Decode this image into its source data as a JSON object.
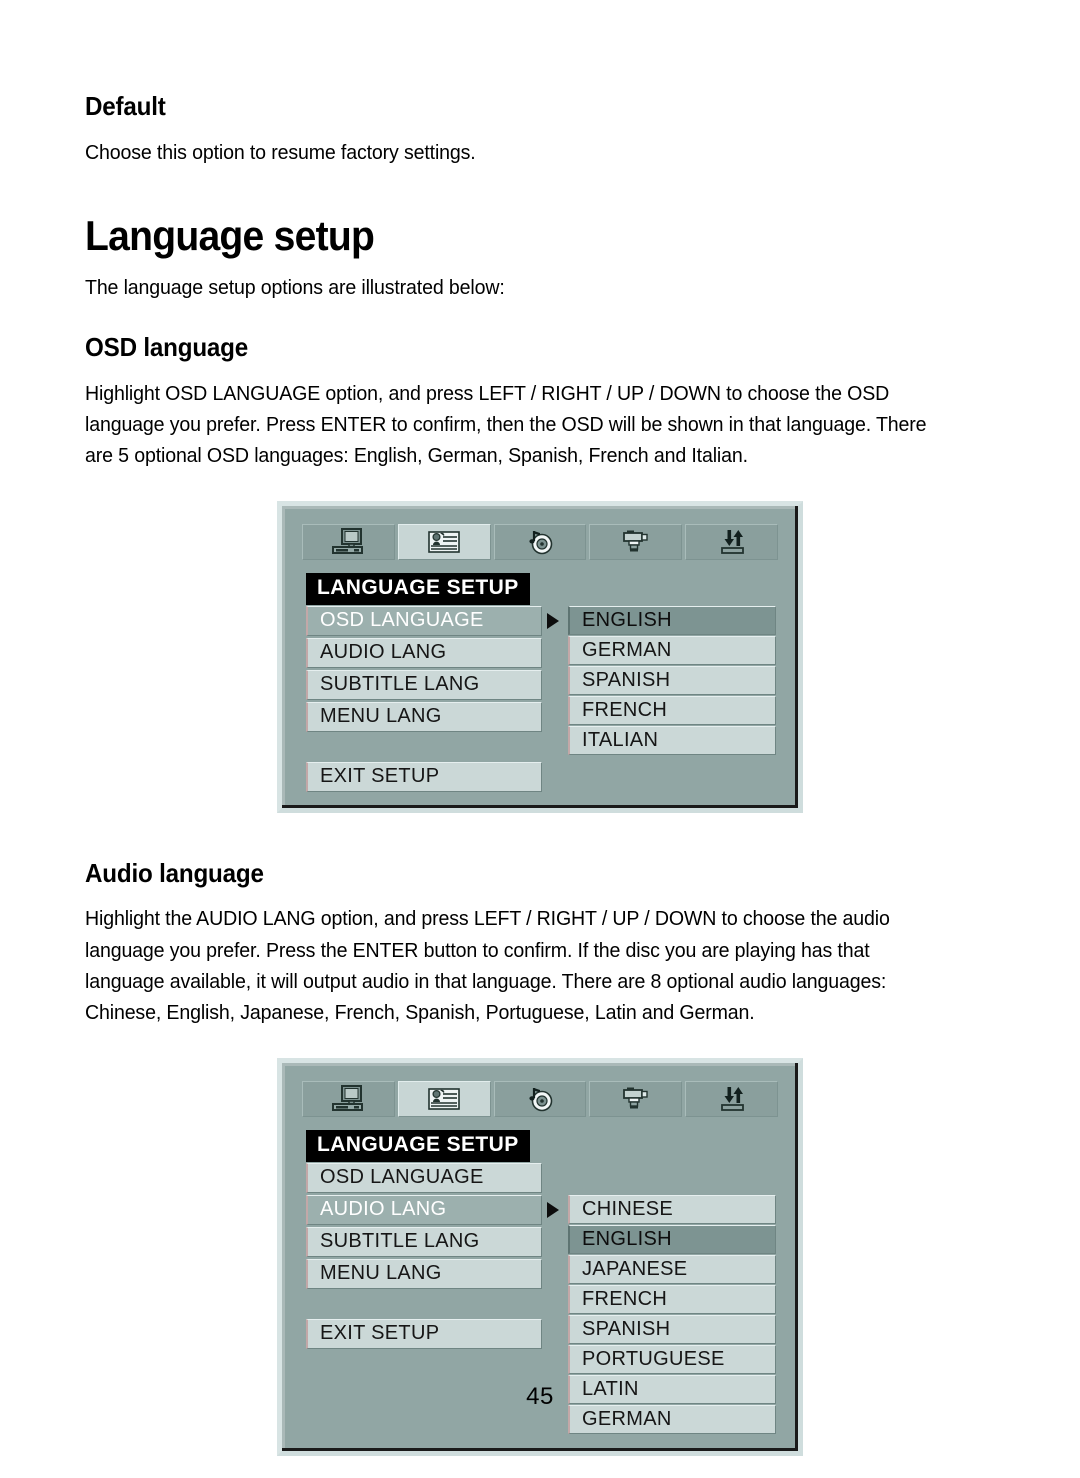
{
  "page": {
    "number": "45"
  },
  "sections": {
    "default": {
      "heading": "Default",
      "body": "Choose this option to resume factory settings."
    },
    "language_setup": {
      "heading": "Language setup",
      "body": "The language setup options are illustrated below:"
    },
    "osd_language": {
      "heading": "OSD language",
      "body": "Highlight OSD LANGUAGE option, and press LEFT / RIGHT / UP / DOWN to choose the OSD language you prefer. Press ENTER to confirm, then the OSD will be shown in that language. There are 5 optional OSD languages: English, German, Spanish, French and Italian."
    },
    "audio_language": {
      "heading": "Audio language",
      "body": "Highlight the AUDIO LANG option, and press LEFT / RIGHT / UP / DOWN to choose the audio language you prefer. Press the ENTER button to confirm. If the disc you are playing has that language available, it will output audio in that language. There are 8 optional audio languages: Chinese, English, Japanese, French, Spanish, Portuguese, Latin and German."
    }
  },
  "osd_tabs": [
    {
      "icon": "monitor-icon",
      "active": false
    },
    {
      "icon": "language-person-icon",
      "active": true
    },
    {
      "icon": "audio-disc-icon",
      "active": false
    },
    {
      "icon": "video-camera-icon",
      "active": false
    },
    {
      "icon": "preference-arrows-icon",
      "active": false
    }
  ],
  "osd_menu_1": {
    "title": "LANGUAGE SETUP",
    "items": [
      {
        "label": "OSD LANGUAGE",
        "selected": true
      },
      {
        "label": "AUDIO LANG",
        "selected": false
      },
      {
        "label": "SUBTITLE LANG",
        "selected": false
      },
      {
        "label": "MENU LANG",
        "selected": false
      }
    ],
    "exit_label": "EXIT SETUP",
    "options": [
      {
        "label": "ENGLISH",
        "highlighted": true
      },
      {
        "label": "GERMAN",
        "highlighted": false
      },
      {
        "label": "SPANISH",
        "highlighted": false
      },
      {
        "label": "FRENCH",
        "highlighted": false
      },
      {
        "label": "ITALIAN",
        "highlighted": false
      }
    ]
  },
  "osd_menu_2": {
    "title": "LANGUAGE SETUP",
    "items": [
      {
        "label": "OSD LANGUAGE",
        "selected": false
      },
      {
        "label": "AUDIO LANG",
        "selected": true
      },
      {
        "label": "SUBTITLE LANG",
        "selected": false
      },
      {
        "label": "MENU LANG",
        "selected": false
      }
    ],
    "exit_label": "EXIT SETUP",
    "options": [
      {
        "label": "CHINESE",
        "highlighted": false
      },
      {
        "label": "ENGLISH",
        "highlighted": true
      },
      {
        "label": "JAPANESE",
        "highlighted": false
      },
      {
        "label": "FRENCH",
        "highlighted": false
      },
      {
        "label": "SPANISH",
        "highlighted": false
      },
      {
        "label": "PORTUGUESE",
        "highlighted": false
      },
      {
        "label": "LATIN",
        "highlighted": false
      },
      {
        "label": "GERMAN",
        "highlighted": false
      }
    ]
  },
  "colors": {
    "osd_background": "#91a6a4",
    "osd_item": "#cbd8d7",
    "osd_selected": "#9cb0ae",
    "osd_highlight": "#7d9492",
    "osd_title_bg": "#000000",
    "tab_active": "#c8d6d5",
    "tab_inactive": "#8a9f9d"
  }
}
